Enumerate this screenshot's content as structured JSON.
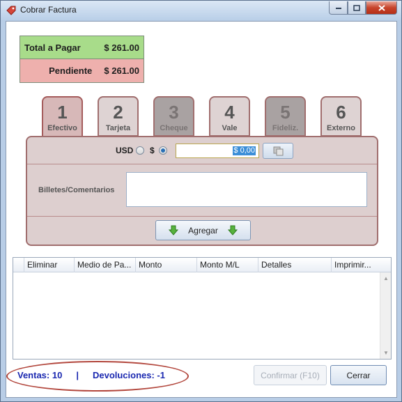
{
  "window": {
    "title": "Cobrar Factura"
  },
  "totals": {
    "total_label": "Total a Pagar",
    "total_value": "$ 261.00",
    "pending_label": "Pendiente",
    "pending_value": "$ 261.00"
  },
  "tabs": [
    {
      "number": "1",
      "label": "Efectivo",
      "state": "active"
    },
    {
      "number": "2",
      "label": "Tarjeta",
      "state": "normal"
    },
    {
      "number": "3",
      "label": "Cheque",
      "state": "disabled"
    },
    {
      "number": "4",
      "label": "Vale",
      "state": "normal"
    },
    {
      "number": "5",
      "label": "Fideliz.",
      "state": "disabled"
    },
    {
      "number": "6",
      "label": "Externo",
      "state": "normal"
    }
  ],
  "payment": {
    "currency_usd": "USD",
    "currency_local": "$",
    "selected_currency": "$",
    "amount": "$ 0,00",
    "comments_label": "Billetes/Comentarios",
    "comments_value": "",
    "add_label": "Agregar"
  },
  "grid": {
    "columns": [
      "Eliminar",
      "Medio de Pa...",
      "Monto",
      "Monto M/L",
      "Detalles",
      "Imprimir..."
    ],
    "rows": []
  },
  "footer": {
    "sales_text": "Ventas: 10",
    "separator": "|",
    "returns_text": "Devoluciones: -1",
    "confirm_label": "Confirmar (F10)",
    "close_label": "Cerrar"
  },
  "colors": {
    "total_bg": "#a8dc8a",
    "pending_bg": "#eeb0ad",
    "tab_border": "#a06e6e",
    "stats_text": "#1a28b0",
    "highlight_oval": "#b2463c"
  }
}
